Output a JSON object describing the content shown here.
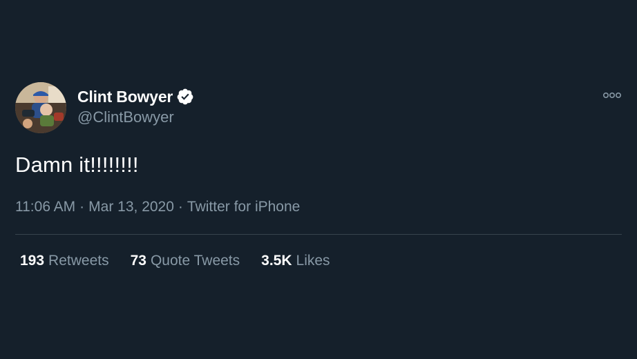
{
  "tweet": {
    "author": {
      "display_name": "Clint Bowyer",
      "handle": "@ClintBowyer",
      "verified": true
    },
    "text": "Damn it!!!!!!!!",
    "time": "11:06 AM",
    "date": "Mar 13, 2020",
    "source": "Twitter for iPhone",
    "separator": "·",
    "stats": [
      {
        "count": "193",
        "label": "Retweets"
      },
      {
        "count": "73",
        "label": "Quote Tweets"
      },
      {
        "count": "3.5K",
        "label": "Likes"
      }
    ]
  },
  "icons": {
    "more": "more-horizontal-icon",
    "verified": "verified-badge-icon"
  },
  "colors": {
    "background": "#15202b",
    "secondary_text": "#8899a6",
    "divider": "#38444d",
    "primary_text": "#ffffff"
  }
}
